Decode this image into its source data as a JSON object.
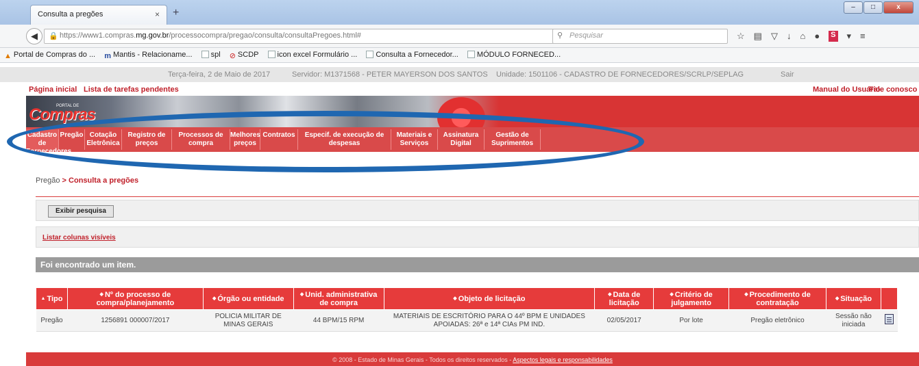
{
  "browser": {
    "tab_title": "Consulta a pregões",
    "tab_close": "×",
    "new_tab": "+",
    "url_prefix": "https://www1.compras.",
    "url_host": "mg.gov.br",
    "url_path": "/processocompra/pregao/consulta/consultaPregoes.html#",
    "search_placeholder": "Pesquisar",
    "bookmarks": [
      "Portal de Compras do ...",
      "Mantis - Relacioname...",
      "spl",
      "SCDP",
      "icon excel Formulário ...",
      "Consulta a Fornecedor...",
      "MÓDULO FORNECED..."
    ]
  },
  "infobar": {
    "date": "Terça-feira, 2 de Maio de 2017",
    "server": "Servidor: M1371568 - PETER MAYERSON DOS SANTOS",
    "unit": "Unidade: 1501106 - CADASTRO DE FORNECEDORES/SCRLP/SEPLAG",
    "logout": "Sair"
  },
  "toplinks": {
    "home": "Página inicial",
    "tasks": "Lista de tarefas pendentes",
    "manual": "Manual do Usuário",
    "contact": "Fale conosco"
  },
  "banner": {
    "logo": "Compras",
    "logo_small": "PORTAL DE"
  },
  "menu": [
    "Cadastro de Fornecedores",
    "Pregão",
    "Cotação Eletrônica",
    "Registro de preços",
    "Processos de compra",
    "Melhores preços",
    "Contratos",
    "Especif. de execução de despesas",
    "Materiais e Serviços",
    "Assinatura Digital",
    "Gestão de Suprimentos"
  ],
  "breadcrumb": {
    "parent": "Pregão",
    "separator": " > ",
    "current": "Consulta a pregões"
  },
  "search_panel": {
    "button": "Exibir pesquisa"
  },
  "columns_panel": {
    "link": "Listar colunas visíveis"
  },
  "result": {
    "message": "Foi encontrado um item."
  },
  "table": {
    "headers": [
      "Tipo",
      "Nº do processo de compra/planejamento",
      "Órgão ou entidade",
      "Unid. administrativa de compra",
      "Objeto de licitação",
      "Data de licitação",
      "Critério de julgamento",
      "Procedimento de contratação",
      "Situação"
    ],
    "rows": [
      {
        "tipo": "Pregão",
        "numero": "1256891 000007/2017",
        "orgao": "POLICIA MILITAR DE MINAS GERAIS",
        "unidade": "44 BPM/15 RPM",
        "objeto": "MATERIAIS DE ESCRITÓRIO PARA O 44º BPM E UNIDADES APOIADAS: 26ª e 14ª CIAs PM IND.",
        "data": "02/05/2017",
        "criterio": "Por lote",
        "procedimento": "Pregão eletrônico",
        "situacao": "Sessão não iniciada"
      }
    ]
  },
  "footer": {
    "text": "© 2008 - Estado de Minas Gerais - Todos os direitos reservados - ",
    "link": "Aspectos legais e responsabilidades"
  },
  "colors": {
    "brand_red": "#d83434",
    "menu_red": "#d94a4a",
    "header_red": "#e63b3b",
    "highlight_ellipse": "#1f67b1",
    "result_bar": "#9b9b9b"
  }
}
